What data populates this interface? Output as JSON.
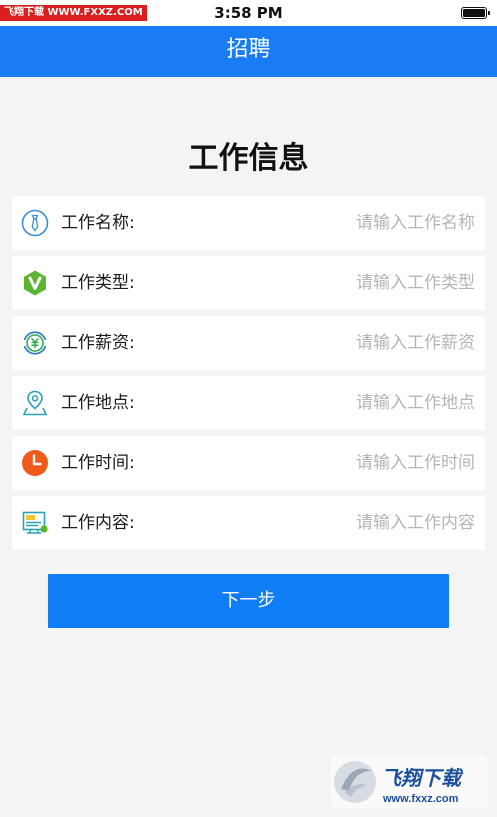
{
  "status_bar": {
    "watermark": "飞翔下载 WWW.FXXZ.COM",
    "time": "3:58 PM"
  },
  "nav": {
    "title": "招聘"
  },
  "section": {
    "title": "工作信息"
  },
  "form": {
    "rows": [
      {
        "label": "工作名称:",
        "placeholder": "请输入工作名称",
        "icon": "tie-icon",
        "color": "#3a8fd6"
      },
      {
        "label": "工作类型:",
        "placeholder": "请输入工作类型",
        "icon": "v-hexagon-icon",
        "color": "#5cb531"
      },
      {
        "label": "工作薪资:",
        "placeholder": "请输入工作薪资",
        "icon": "yen-coin-icon",
        "color": "#2f7ec9"
      },
      {
        "label": "工作地点:",
        "placeholder": "请输入工作地点",
        "icon": "map-pin-icon",
        "color": "#2aa0b5"
      },
      {
        "label": "工作时间:",
        "placeholder": "请输入工作时间",
        "icon": "clock-icon",
        "color": "#f05a1a"
      },
      {
        "label": "工作内容:",
        "placeholder": "请输入工作内容",
        "icon": "document-icon",
        "color": "#2aa0b5"
      }
    ]
  },
  "next_button": {
    "label": "下一步",
    "color": "#0f7ef6"
  },
  "logo_watermark": {
    "text": "飞翔下载",
    "url": "www.fxxz.com"
  },
  "colors": {
    "accent": "#1a7cf4",
    "background": "#f4f4f4"
  }
}
